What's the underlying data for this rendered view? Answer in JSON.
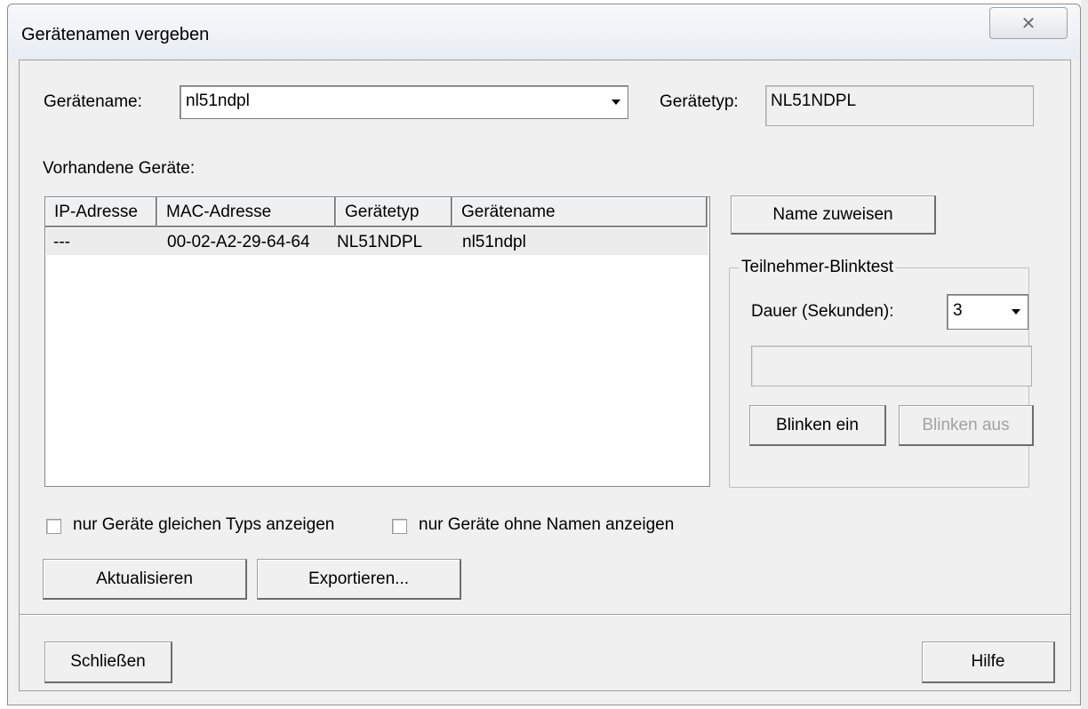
{
  "window": {
    "title": "Gerätenamen vergeben",
    "close_glyph": "✕"
  },
  "device_name": {
    "label": "Gerätename:",
    "value": "nl51ndpl"
  },
  "device_type": {
    "label": "Gerätetyp:",
    "value": "NL51NDPL"
  },
  "devices_list": {
    "label": "Vorhandene Geräte:",
    "columns": [
      "IP-Adresse",
      "MAC-Adresse",
      "Gerätetyp",
      "Gerätename"
    ],
    "rows": [
      {
        "ip": "---",
        "mac": "00-02-A2-29-64-64",
        "type": "NL51NDPL",
        "name": "nl51ndpl"
      }
    ]
  },
  "assign_button": "Name zuweisen",
  "blink_test": {
    "title": "Teilnehmer-Blinktest",
    "duration_label": "Dauer (Sekunden):",
    "duration_value": "3",
    "on_button": "Blinken ein",
    "off_button": "Blinken aus"
  },
  "filters": {
    "same_type_label": "nur Geräte gleichen Typs anzeigen",
    "same_type_checked": false,
    "unnamed_label": "nur Geräte ohne Namen anzeigen",
    "unnamed_checked": false
  },
  "buttons": {
    "refresh": "Aktualisieren",
    "export": "Exportieren...",
    "close": "Schließen",
    "help": "Hilfe"
  }
}
